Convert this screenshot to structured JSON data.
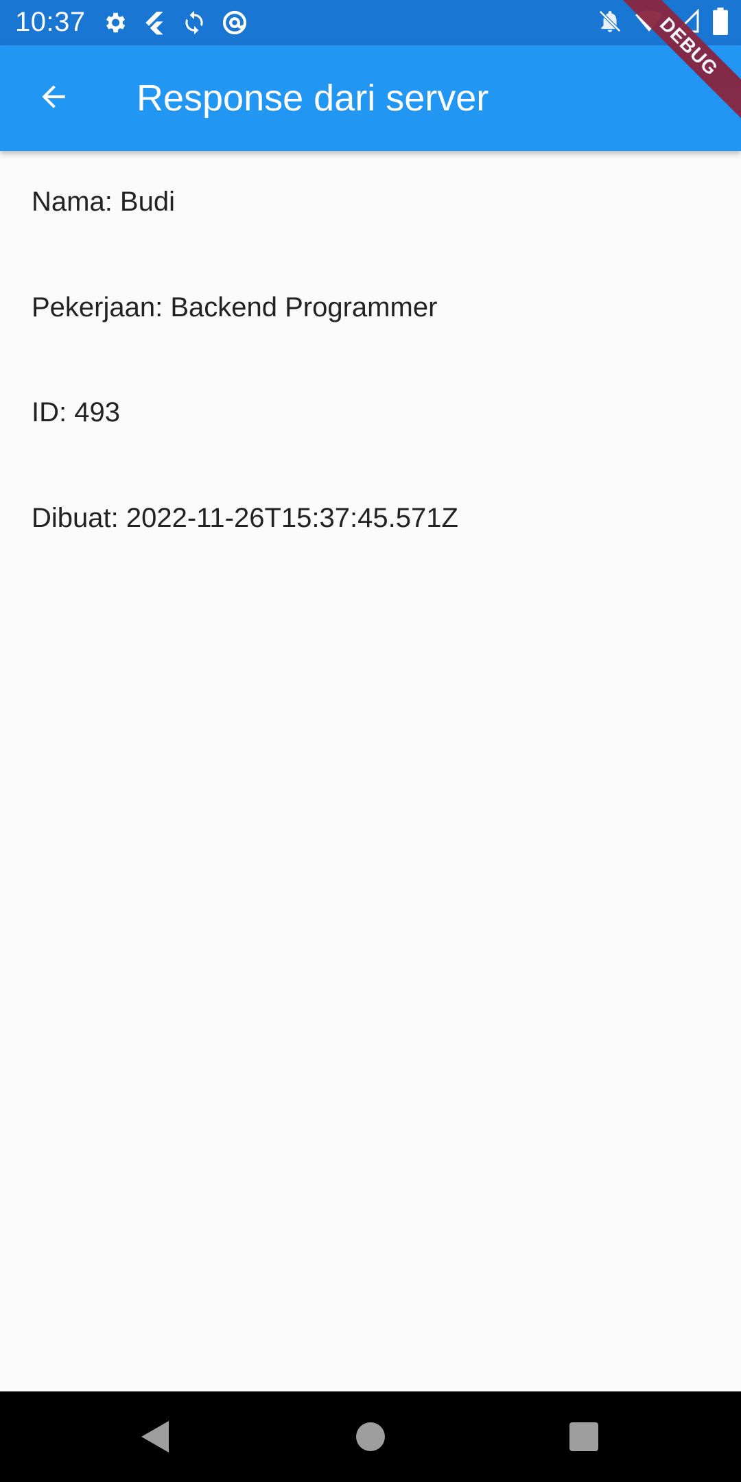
{
  "status_bar": {
    "time": "10:37",
    "left_icons": [
      "settings-icon",
      "flutter-icon",
      "sync-icon",
      "at-sign-icon"
    ],
    "right_icons": [
      "notifications-off-icon",
      "wifi-icon",
      "cell-signal-icon",
      "battery-icon"
    ]
  },
  "debug_banner": {
    "label": "DEBUG"
  },
  "app_bar": {
    "title": "Response dari server",
    "back_icon": "arrow-back-icon",
    "color": "#2196f3"
  },
  "content": {
    "name_line": "Nama: Budi",
    "job_line": "Pekerjaan: Backend Programmer",
    "id_line": "ID: 493",
    "created_line": "Dibuat: 2022-11-26T15:37:45.571Z"
  },
  "nav_bar": {
    "buttons": [
      "back-triangle-icon",
      "home-circle-icon",
      "recents-square-icon"
    ]
  }
}
